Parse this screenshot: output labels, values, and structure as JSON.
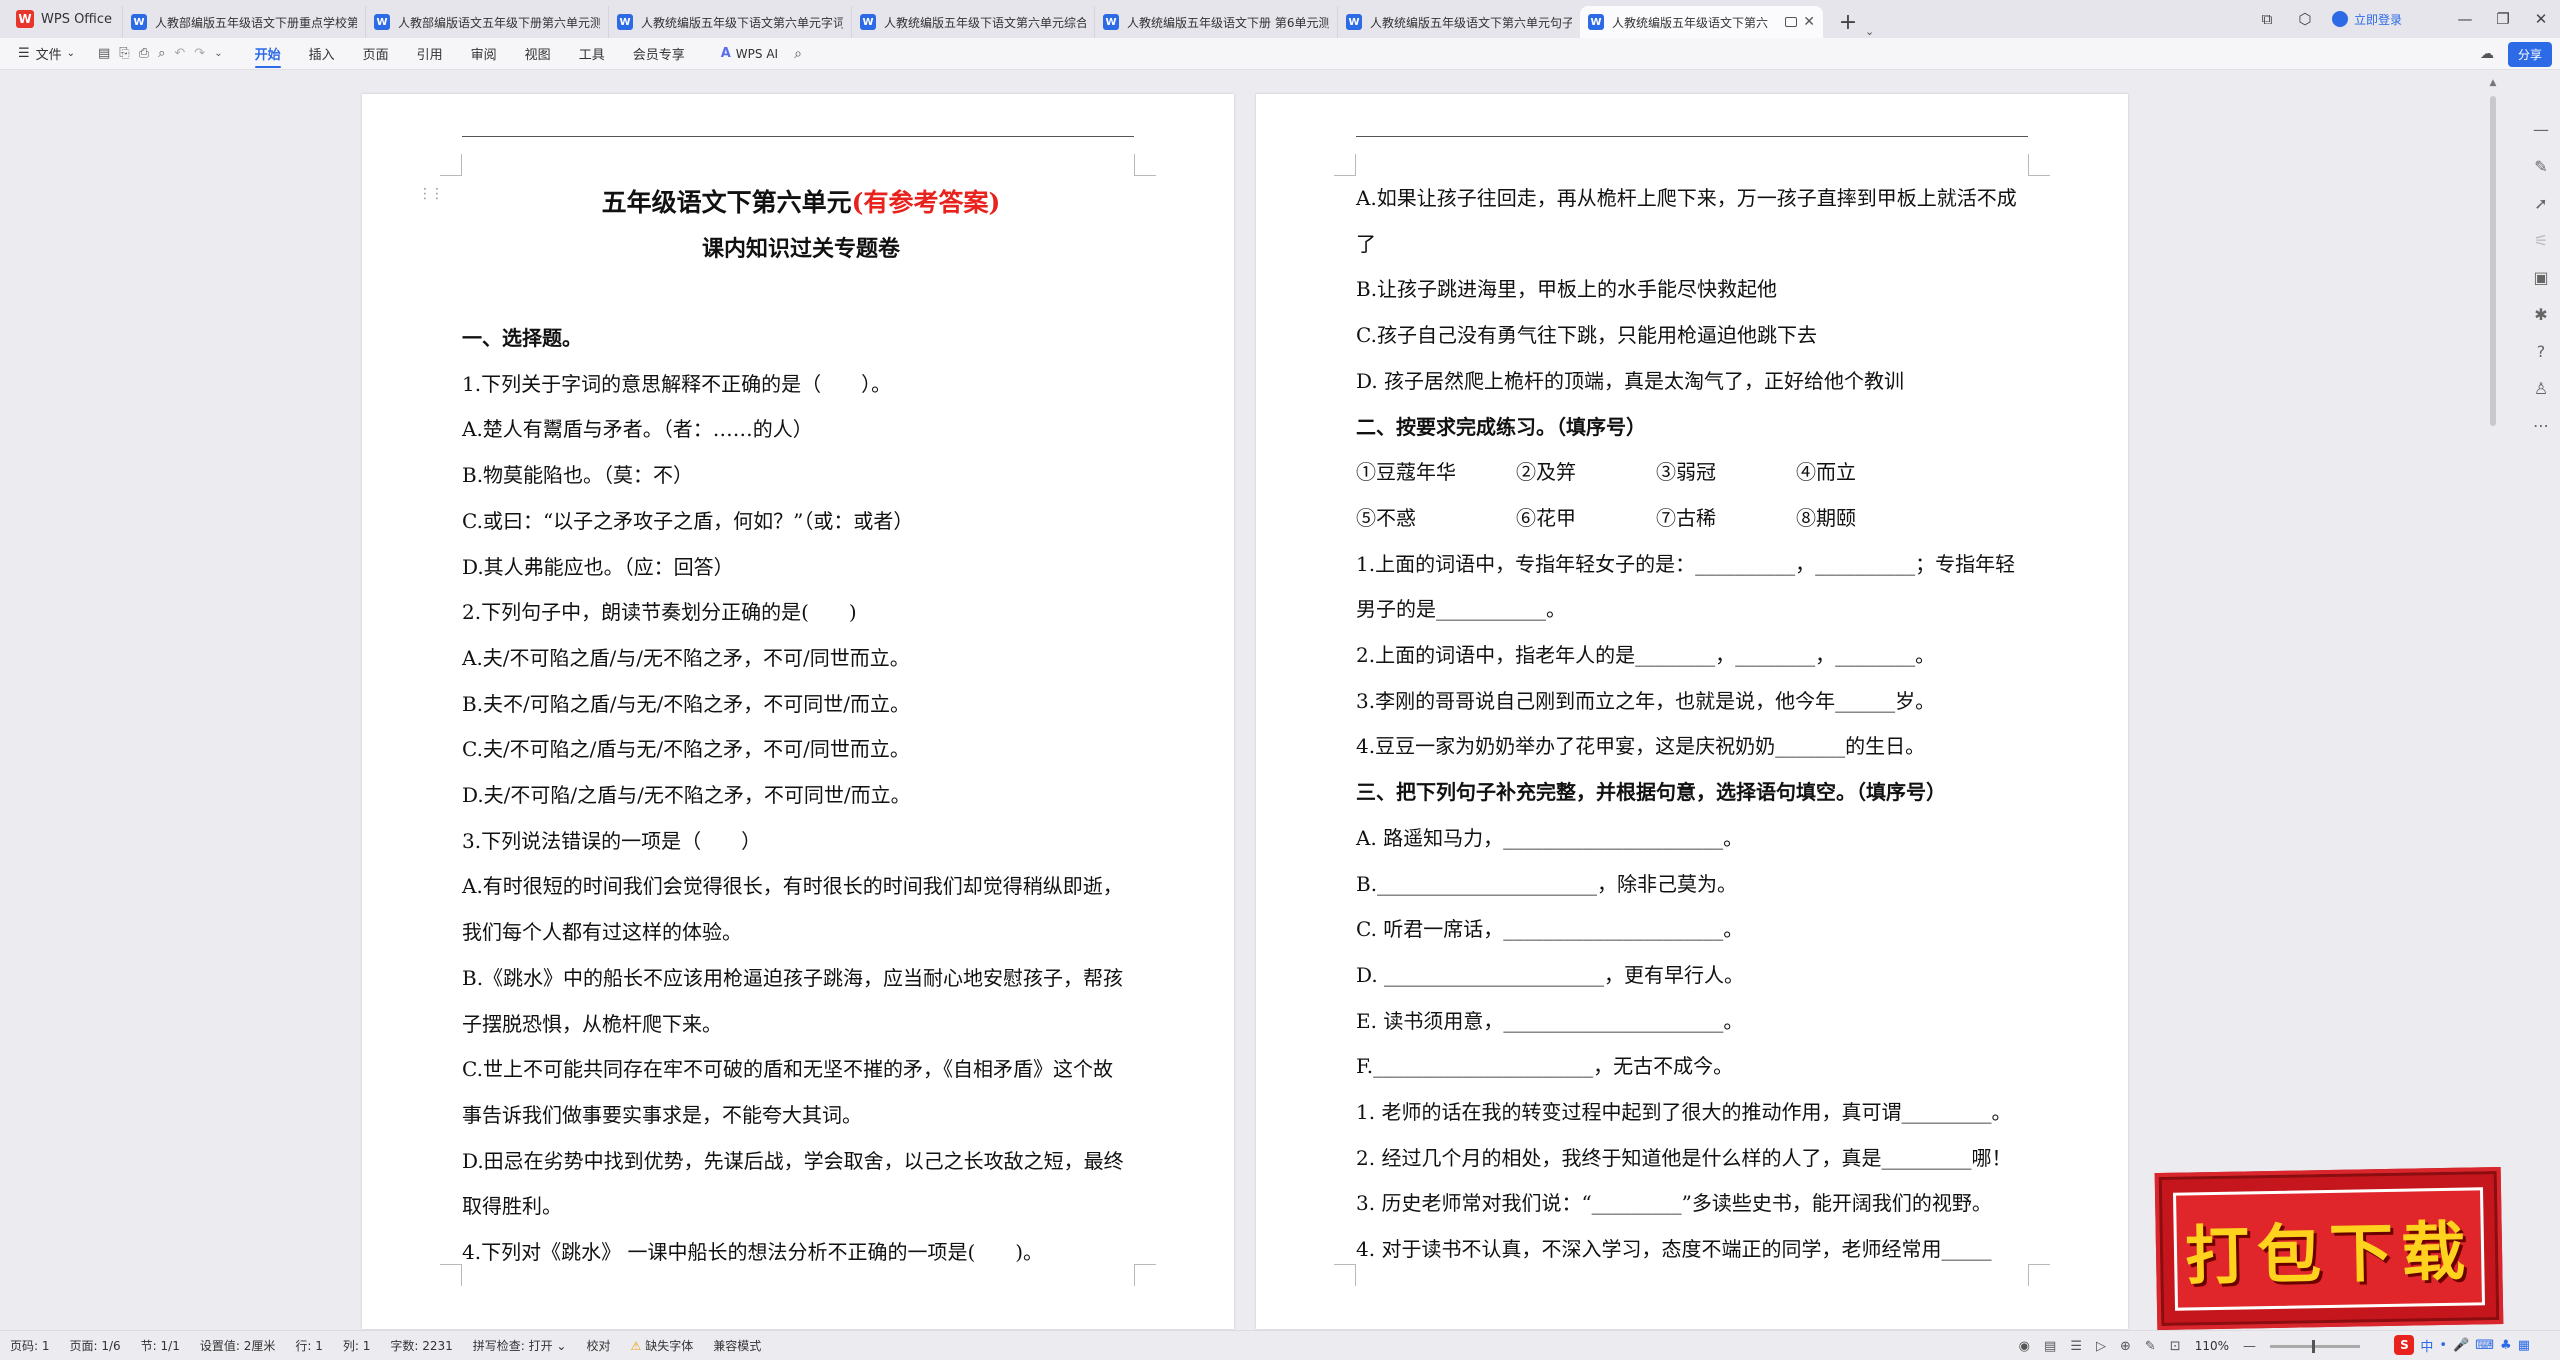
{
  "app": {
    "name": "WPS Office",
    "logo_letter": "W"
  },
  "tabs": [
    {
      "label": "人教部编版五年级语文下册重点学校第",
      "active": false
    },
    {
      "label": "人教部编版语文五年级下册第六单元测",
      "active": false
    },
    {
      "label": "人教统编版五年级下语文第六单元字词",
      "active": false
    },
    {
      "label": "人教统编版五年级下语文第六单元综合",
      "active": false
    },
    {
      "label": "人教统编版五年级语文下册 第6单元测",
      "active": false
    },
    {
      "label": "人教统编版五年级语文下第六单元句子",
      "active": false
    },
    {
      "label": "人教统编版五年级语文下第六",
      "active": true
    }
  ],
  "tab_icon_letter": "W",
  "tab_add": "+",
  "tab_more": "⌄",
  "window": {
    "login_label": "立即登录"
  },
  "ribbon": {
    "file_label": "文件",
    "tabs": [
      "开始",
      "插入",
      "页面",
      "引用",
      "审阅",
      "视图",
      "工具",
      "会员专享"
    ],
    "active_tab": "开始",
    "ai_label": "WPS AI",
    "share_label": "分享"
  },
  "page1": {
    "title_main": "五年级语文下第六单元",
    "title_red": "(有参考答案)",
    "subtitle": "课内知识过关专题卷",
    "lines": [
      {
        "text": "一、选择题。",
        "bold": true
      },
      {
        "text": "1.下列关于字词的意思解释不正确的是（　　）。"
      },
      {
        "text": "A.楚人有鬻盾与矛者。（者：……的人）"
      },
      {
        "text": "B.物莫能陷也。（莫：不）"
      },
      {
        "text": "C.或曰：“以子之矛攻子之盾，何如？”（或：或者）"
      },
      {
        "text": "D.其人弗能应也。（应：回答）"
      },
      {
        "text": "2.下列句子中，朗读节奏划分正确的是(　　)"
      },
      {
        "text": "A.夫/不可陷之盾/与/无不陷之矛，不可/同世而立。"
      },
      {
        "text": "B.夫不/可陷之盾/与无/不陷之矛，不可同世/而立。"
      },
      {
        "text": "C.夫/不可陷之/盾与无/不陷之矛，不可/同世而立。"
      },
      {
        "text": "D.夫/不可陷/之盾与/无不陷之矛，不可同世/而立。"
      },
      {
        "text": "3.下列说法错误的一项是（　　）"
      },
      {
        "text": "A.有时很短的时间我们会觉得很长，有时很长的时间我们却觉得稍纵即逝，"
      },
      {
        "text": "我们每个人都有过这样的体验。"
      },
      {
        "text": "B.《跳水》中的船长不应该用枪逼迫孩子跳海，应当耐心地安慰孩子，帮孩"
      },
      {
        "text": "子摆脱恐惧，从桅杆爬下来。"
      },
      {
        "text": "C.世上不可能共同存在牢不可破的盾和无坚不摧的矛，《自相矛盾》这个故"
      },
      {
        "text": "事告诉我们做事要实事求是，不能夸大其词。"
      },
      {
        "text": "D.田忌在劣势中找到优势，先谋后战，学会取舍，以己之长攻敌之短，最终"
      },
      {
        "text": "取得胜利。"
      },
      {
        "text": "4.下列对《跳水》 一课中船长的想法分析不正确的一项是(　　)。"
      }
    ]
  },
  "page2": {
    "lines": [
      {
        "text": "A.如果让孩子往回走，再从桅杆上爬下来，万一孩子直摔到甲板上就活不成"
      },
      {
        "text": "了"
      },
      {
        "text": "B.让孩子跳进海里，甲板上的水手能尽快救起他"
      },
      {
        "text": "C.孩子自己没有勇气往下跳，只能用枪逼迫他跳下去"
      },
      {
        "text": "D. 孩子居然爬上桅杆的顶端，真是太淘气了，正好给他个教训"
      },
      {
        "text": "二、按要求完成练习。（填序号）",
        "bold": true
      },
      {
        "text": "  ①豆蔻年华　　　②及笄　　　　③弱冠　　　　④而立"
      },
      {
        "text": "⑤不惑　　　　　⑥花甲　　　　⑦古稀　　　　⑧期颐"
      },
      {
        "text": "1.上面的词语中，专指年轻女子的是：__________，__________；专指年轻"
      },
      {
        "text": "男子的是___________。"
      },
      {
        "text": "2.上面的词语中，指老年人的是________，________，________。"
      },
      {
        "text": "3.李刚的哥哥说自己刚到而立之年，也就是说，他今年______岁。"
      },
      {
        "text": "4.豆豆一家为奶奶举办了花甲宴，这是庆祝奶奶_______的生日。"
      },
      {
        "text": "三、把下列句子补充完整，并根据句意，选择语句填空。（填序号）",
        "bold": true
      },
      {
        "text": "A. 路遥知马力，______________________。"
      },
      {
        "text": "B.______________________，除非己莫为。"
      },
      {
        "text": "C. 听君一席话，______________________。"
      },
      {
        "text": "D. ______________________，更有早行人。"
      },
      {
        "text": "E. 读书须用意，______________________。"
      },
      {
        "text": "F.______________________，无古不成今。"
      },
      {
        "text": "1. 老师的话在我的转变过程中起到了很大的推动作用，真可谓_________。"
      },
      {
        "text": "2. 经过几个月的相处，我终于知道他是什么样的人了，真是_________哪！"
      },
      {
        "text": "3. 历史老师常对我们说：“_________”多读些史书，能开阔我们的视野。"
      },
      {
        "text": "4. 对于读书不认真，不深入学习，态度不端正的同学，老师经常用_____"
      }
    ]
  },
  "status": {
    "page_num": "页码: 1",
    "pages": "页面: 1/6",
    "section": "节: 1/1",
    "setting": "设置值: 2厘米",
    "row": "行: 1",
    "col": "列: 1",
    "word_count": "字数: 2231",
    "spell": "拼写检查: 打开 ⌄",
    "proof": "校对",
    "missing_font": "缺失字体",
    "compat": "兼容模式",
    "zoom": "110%"
  },
  "ime": {
    "logo": "S",
    "lang": "中"
  },
  "download_badge": {
    "text": "打包下载"
  }
}
